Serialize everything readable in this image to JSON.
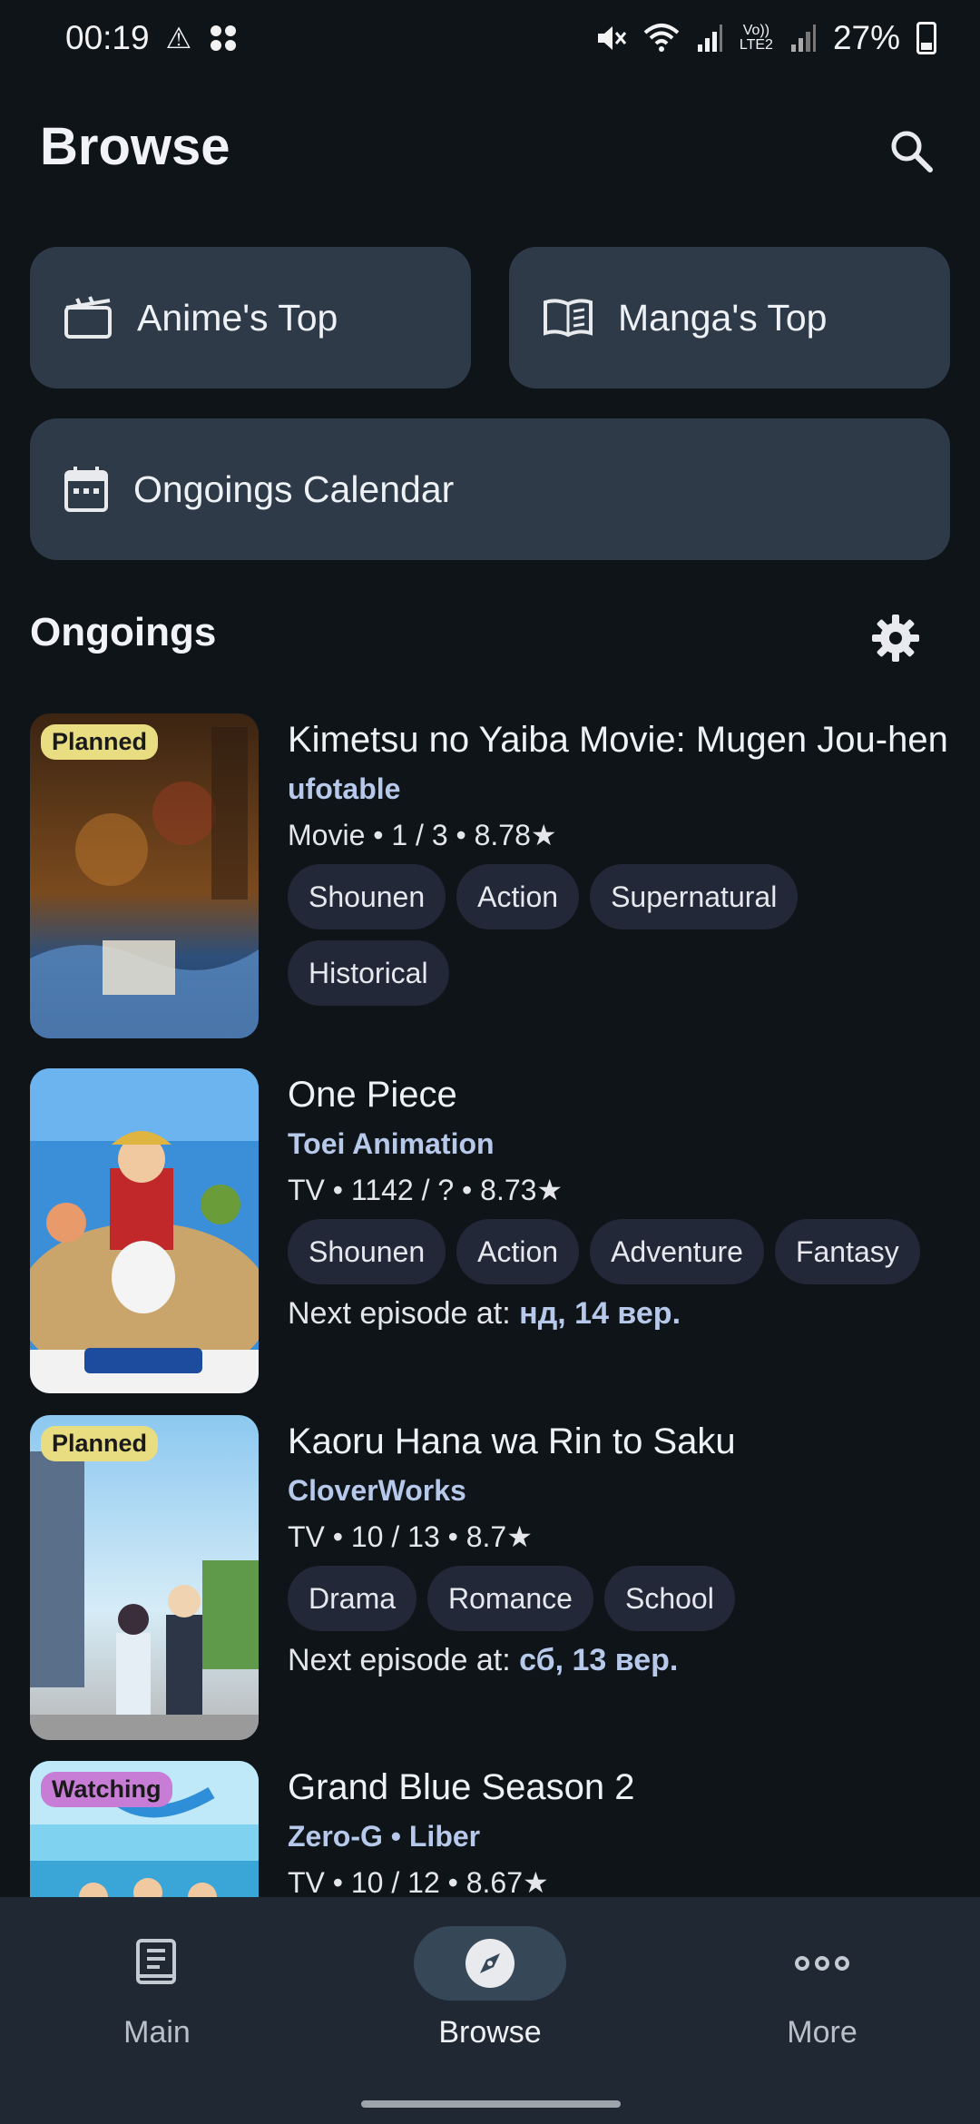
{
  "status_bar": {
    "time": "00:19",
    "battery": "27%",
    "icons": [
      "warning-icon",
      "apps-icon",
      "mute-icon",
      "wifi-icon",
      "signal-icon",
      "volte-icon",
      "signal-icon-2",
      "battery-icon"
    ],
    "volte_label": "Vo))\nLTE2"
  },
  "header": {
    "title": "Browse"
  },
  "quick_links": {
    "anime_top": "Anime's Top",
    "manga_top": "Manga's Top",
    "calendar": "Ongoings Calendar"
  },
  "section": {
    "title": "Ongoings"
  },
  "ongoings": [
    {
      "title": "Kimetsu no Yaiba Movie: Mugen Jou-hen",
      "studio": "ufotable",
      "meta": "Movie • 1 / 3 • 8.78★",
      "badge": "Planned",
      "genres": [
        "Shounen",
        "Action",
        "Supernatural",
        "Historical"
      ],
      "next_label": "",
      "next_date": ""
    },
    {
      "title": "One Piece",
      "studio": "Toei Animation",
      "meta": "TV • 1142 / ? • 8.73★",
      "badge": "",
      "genres": [
        "Shounen",
        "Action",
        "Adventure",
        "Fantasy"
      ],
      "next_label": "Next episode at: ",
      "next_date": "нд, 14 вер."
    },
    {
      "title": "Kaoru Hana wa Rin to Saku",
      "studio": "CloverWorks",
      "meta": "TV • 10 / 13 • 8.7★",
      "badge": "Planned",
      "genres": [
        "Drama",
        "Romance",
        "School"
      ],
      "next_label": "Next episode at: ",
      "next_date": "сб, 13 вер."
    },
    {
      "title": "Grand Blue Season 2",
      "studio": "Zero-G • Liber",
      "meta": "TV • 10 / 12 • 8.67★",
      "badge": "Watching",
      "genres": [],
      "next_label": "",
      "next_date": ""
    }
  ],
  "bottom_nav": {
    "main": "Main",
    "browse": "Browse",
    "more": "More"
  },
  "colors": {
    "background": "#0f1419",
    "card": "#2e3a47",
    "accent_text": "#b7c9ea",
    "chip": "#232838",
    "badge_planned": "#e9dd82",
    "badge_watching": "#c77dd6",
    "nav_bg": "#202833",
    "nav_active": "#364758"
  }
}
